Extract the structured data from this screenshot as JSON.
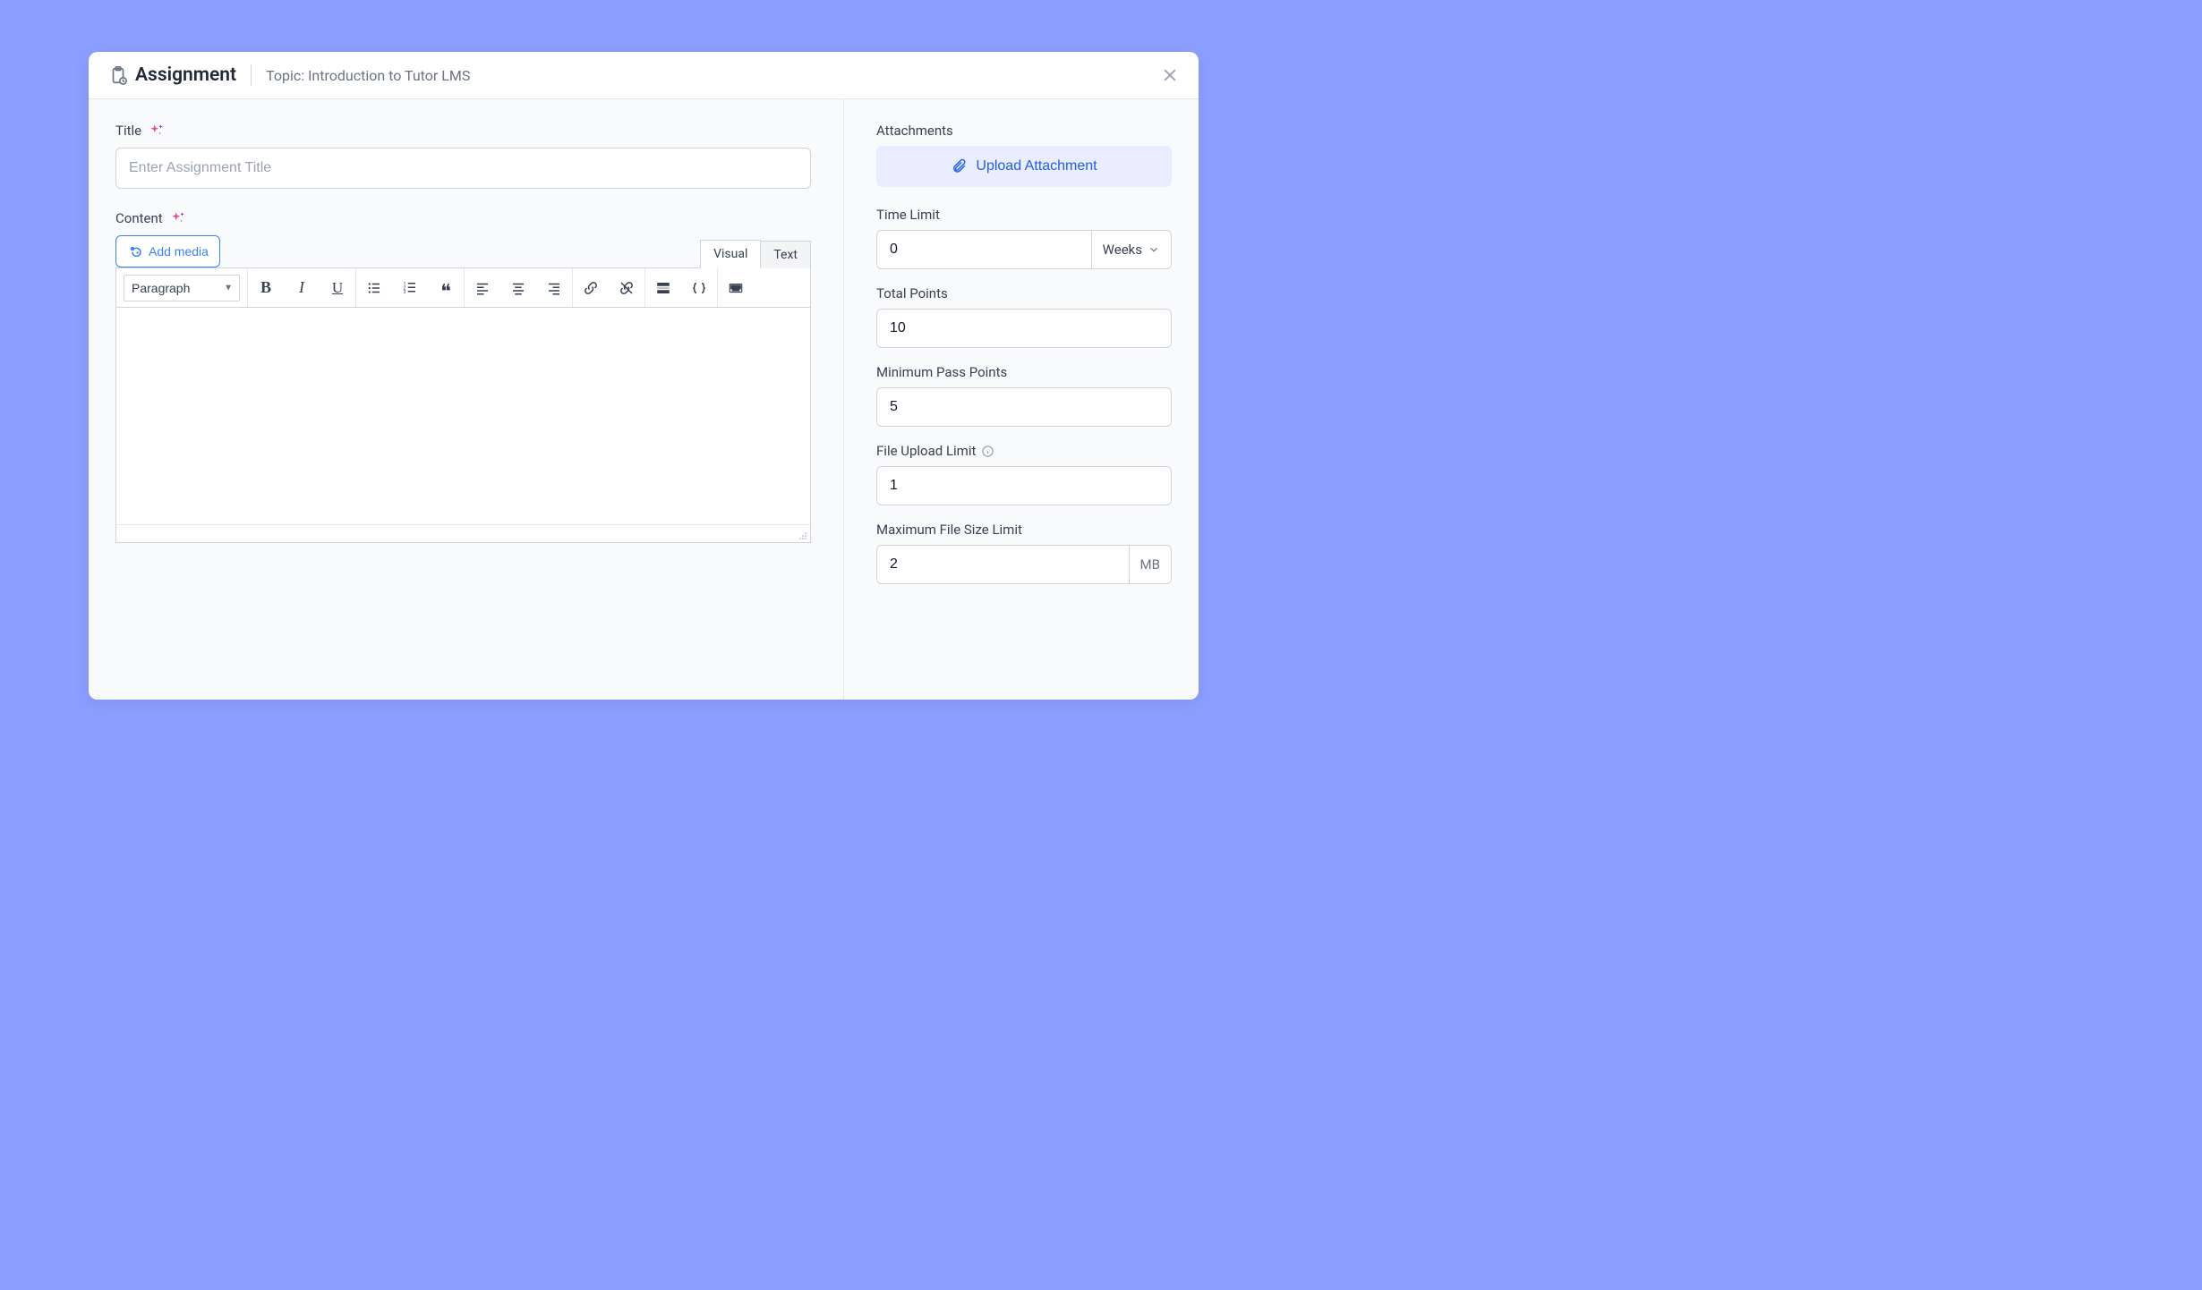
{
  "header": {
    "title": "Assignment",
    "topic": "Topic: Introduction to Tutor LMS"
  },
  "left": {
    "title_label": "Title",
    "title_placeholder": "Enter Assignment Title",
    "content_label": "Content",
    "add_media": "Add media",
    "tab_visual": "Visual",
    "tab_text": "Text",
    "format_dropdown": "Paragraph"
  },
  "right": {
    "attachments_label": "Attachments",
    "upload_label": "Upload Attachment",
    "time_limit_label": "Time Limit",
    "time_limit_value": "0",
    "time_limit_unit": "Weeks",
    "total_points_label": "Total Points",
    "total_points_value": "10",
    "min_pass_label": "Minimum Pass Points",
    "min_pass_value": "5",
    "file_upload_label": "File Upload Limit",
    "file_upload_value": "1",
    "max_size_label": "Maximum File Size Limit",
    "max_size_value": "2",
    "max_size_unit": "MB"
  }
}
